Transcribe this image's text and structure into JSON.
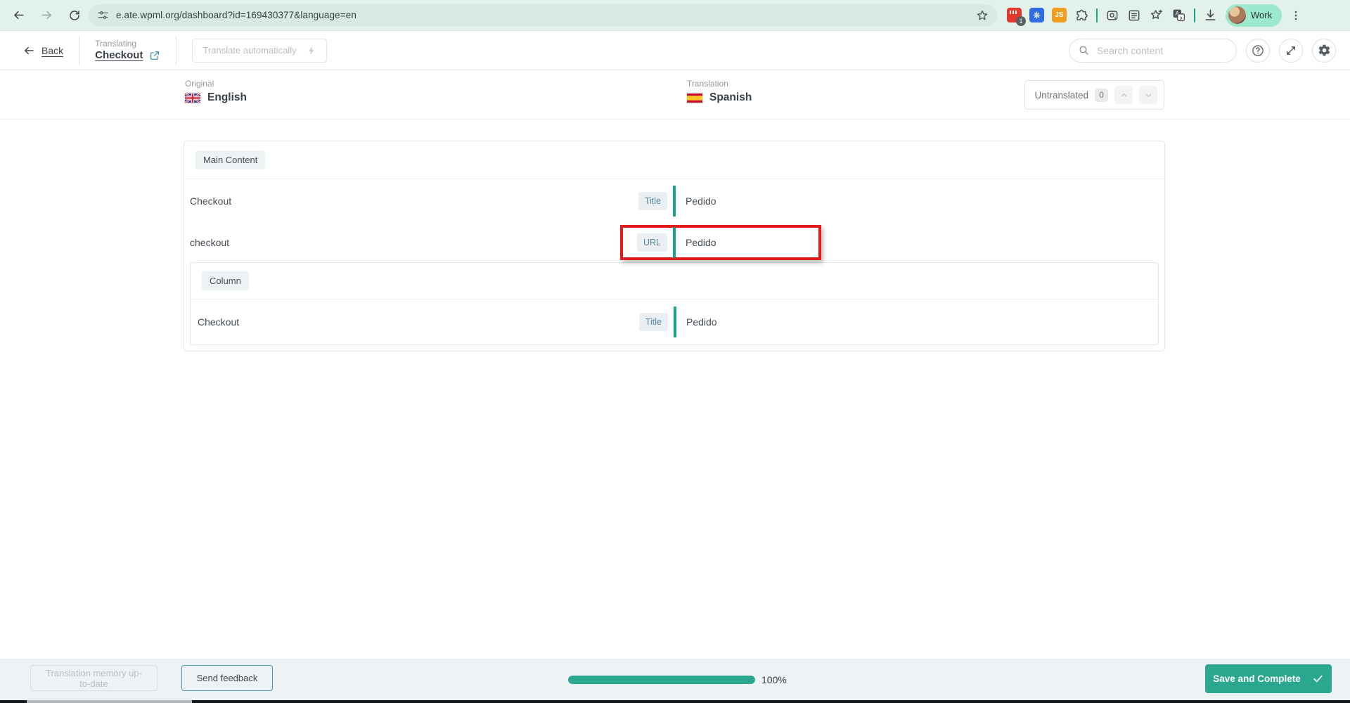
{
  "browser": {
    "url": "e.ate.wpml.org/dashboard?id=169430377&language=en",
    "profile_label": "Work",
    "extensions": {
      "js_label": "JS",
      "badge_count": "1"
    }
  },
  "toolbar": {
    "back_label": "Back",
    "translating_label": "Translating",
    "document_title": "Checkout",
    "translate_auto_label": "Translate automatically",
    "search_placeholder": "Search content"
  },
  "language_header": {
    "original_label": "Original",
    "original_language": "English",
    "translation_label": "Translation",
    "translation_language": "Spanish",
    "filter_label": "Untranslated",
    "filter_count": "0"
  },
  "content": {
    "section_label": "Main Content",
    "rows": [
      {
        "source": "Checkout",
        "field_type": "Title",
        "translation": "Pedido",
        "highlighted": false
      },
      {
        "source": "checkout",
        "field_type": "URL",
        "translation": "Pedido",
        "highlighted": true
      }
    ],
    "subsection": {
      "label": "Column",
      "rows": [
        {
          "source": "Checkout",
          "field_type": "Title",
          "translation": "Pedido"
        }
      ]
    }
  },
  "footer": {
    "memory_status_label": "Translation memory up-to-date",
    "feedback_label": "Send feedback",
    "progress_percent": 100,
    "progress_label": "100%",
    "save_label": "Save and Complete"
  },
  "colors": {
    "accent_teal": "#1ba28a",
    "save_button_green": "#2aa78e",
    "highlight_red": "#e11c1c",
    "badge_text_blue": "#5d87a1",
    "chrome_mint": "#e3f1eb",
    "profile_pill_mint": "#9ce9ce",
    "footer_bg": "#edf2f4"
  }
}
